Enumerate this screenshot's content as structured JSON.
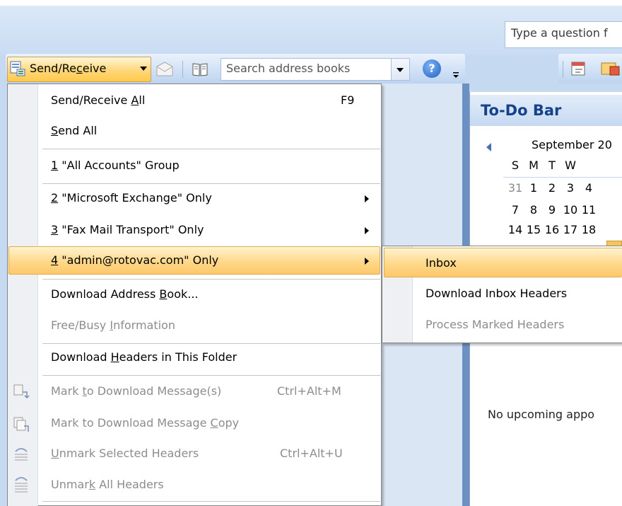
{
  "search": {
    "question_placeholder": "Type a question f",
    "address_placeholder": "Search address books"
  },
  "toolbar": {
    "send_receive": {
      "before": "Send/Re",
      "accel": "c",
      "after": "eive"
    },
    "help_glyph": "?"
  },
  "todo_bar": {
    "title": "To-Do Bar",
    "calendar": {
      "month": "September 20",
      "day_headers": [
        "S",
        "M",
        "T",
        "W"
      ],
      "rows": [
        [
          "31",
          "1",
          "2",
          "3",
          "4"
        ],
        [
          "7",
          "8",
          "9",
          "10",
          "11"
        ],
        [
          "14",
          "15",
          "16",
          "17",
          "18"
        ]
      ]
    },
    "no_appointments": "No upcoming appo"
  },
  "menu": {
    "items": [
      {
        "before": "Send/Receive ",
        "accel": "A",
        "after": "ll",
        "shortcut": "F9"
      },
      {
        "before": "",
        "accel": "S",
        "after": "end All"
      },
      {
        "before": "",
        "accel": "1",
        "after": " \"All Accounts\" Group"
      },
      {
        "before": "",
        "accel": "2",
        "after": " \"Microsoft Exchange\" Only"
      },
      {
        "before": "",
        "accel": "3",
        "after": " \"Fax Mail Transport\" Only"
      },
      {
        "before": "",
        "accel": "4",
        "after": " \"admin@rotovac.com\" Only"
      },
      {
        "before": "Download Address ",
        "accel": "B",
        "after": "ook..."
      },
      {
        "before": "Free/Busy ",
        "accel": "I",
        "after": "nformation"
      },
      {
        "before": "Download ",
        "accel": "H",
        "after": "eaders in This Folder"
      },
      {
        "before": "Mark ",
        "accel": "t",
        "after": "o Download Message(s)",
        "shortcut": "Ctrl+Alt+M"
      },
      {
        "before": "Mark to Download Message ",
        "accel": "C",
        "after": "opy"
      },
      {
        "before": "",
        "accel": "U",
        "after": "nmark Selected Headers",
        "shortcut": "Ctrl+Alt+U"
      },
      {
        "before": "Unmar",
        "accel": "k",
        "after": " All Headers"
      }
    ]
  },
  "submenu": {
    "items": [
      "Inbox",
      "Download Inbox Headers",
      "Process Marked Headers"
    ]
  },
  "colors": {
    "accent": "#15428b",
    "highlight": "#ffd88a",
    "disabled_text": "#8d8d8d",
    "menu_gutter": "#eef0f4"
  }
}
